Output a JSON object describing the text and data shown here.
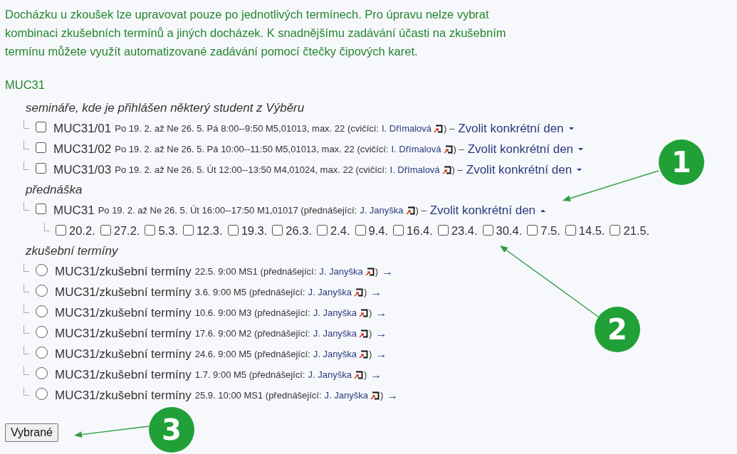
{
  "intro": "Docházku u zkoušek lze upravovat pouze po jednotlivých termínech. Pro úpravu nelze vybrat kombinaci zkušebních termínů a jiných docházek. K snadnějšímu zadávání účasti na zkušebním termínu můžete využít automatizované zadávání pomocí čtečky čipových karet.",
  "course": "MUC31",
  "groups": [
    {
      "heading": "semináře, kde je přihlášen některý student z Výběru",
      "items": [
        {
          "kind": "checkbox",
          "checked": false,
          "code": "MUC31/01",
          "details": "Po 19. 2. až Ne 26. 5. Pá 8:00--9:50 M5,01013, max. 22 (cvičící:",
          "person": "I. Dřímalová",
          "after": ") –",
          "link": "Zvolit konkrétní den",
          "expanded": false
        },
        {
          "kind": "checkbox",
          "checked": false,
          "code": "MUC31/02",
          "details": "Po 19. 2. až Ne 26. 5. Pá 10:00--11:50 M5,01013, max. 22 (cvičící:",
          "person": "I. Dřímalová",
          "after": ") –",
          "link": "Zvolit konkrétní den",
          "expanded": false
        },
        {
          "kind": "checkbox",
          "checked": false,
          "code": "MUC31/03",
          "details": "Po 19. 2. až Ne 26. 5. Út 12:00--13:50 M4,01024, max. 22 (cvičící:",
          "person": "I. Dřímalová",
          "after": ") –",
          "link": "Zvolit konkrétní den",
          "expanded": false
        }
      ]
    },
    {
      "heading": "přednáška",
      "items": [
        {
          "kind": "checkbox",
          "checked": false,
          "code": "MUC31",
          "details": "Po 19. 2. až Ne 26. 5. Út 16:00--17:50 M1,01017 (přednášející:",
          "person": "J. Janyška",
          "after": ") –",
          "link": "Zvolit konkrétní den",
          "expanded": true,
          "dates": [
            {
              "label": "20.2.",
              "checked": false
            },
            {
              "label": "27.2.",
              "checked": false
            },
            {
              "label": "5.3.",
              "checked": false
            },
            {
              "label": "12.3.",
              "checked": false
            },
            {
              "label": "19.3.",
              "checked": false
            },
            {
              "label": "26.3.",
              "checked": false
            },
            {
              "label": "2.4.",
              "checked": false
            },
            {
              "label": "9.4.",
              "checked": false
            },
            {
              "label": "16.4.",
              "checked": false
            },
            {
              "label": "23.4.",
              "checked": false
            },
            {
              "label": "30.4.",
              "checked": false
            },
            {
              "label": "7.5.",
              "checked": false
            },
            {
              "label": "14.5.",
              "checked": false
            },
            {
              "label": "21.5.",
              "checked": false
            }
          ]
        }
      ]
    },
    {
      "heading": "zkušební termíny",
      "items": [
        {
          "kind": "radio",
          "selected": false,
          "code": "MUC31/zkušební termíny",
          "details": "22.5. 9:00 MS1 (přednášející:",
          "person": "J. Janyška",
          "after": ")",
          "arrow": "→"
        },
        {
          "kind": "radio",
          "selected": false,
          "code": "MUC31/zkušební termíny",
          "details": "3.6. 9:00 M5 (přednášející:",
          "person": "J. Janyška",
          "after": ")",
          "arrow": "→"
        },
        {
          "kind": "radio",
          "selected": false,
          "code": "MUC31/zkušební termíny",
          "details": "10.6. 9:00 M3 (přednášející:",
          "person": "J. Janyška",
          "after": ")",
          "arrow": "→"
        },
        {
          "kind": "radio",
          "selected": false,
          "code": "MUC31/zkušební termíny",
          "details": "17.6. 9:00 M2 (přednášející:",
          "person": "J. Janyška",
          "after": ")",
          "arrow": "→"
        },
        {
          "kind": "radio",
          "selected": false,
          "code": "MUC31/zkušební termíny",
          "details": "24.6. 9:00 M5 (přednášející:",
          "person": "J. Janyška",
          "after": ")",
          "arrow": "→"
        },
        {
          "kind": "radio",
          "selected": false,
          "code": "MUC31/zkušební termíny",
          "details": "1.7. 9:00 M5 (přednášející:",
          "person": "J. Janyška",
          "after": ")",
          "arrow": "→"
        },
        {
          "kind": "radio",
          "selected": false,
          "code": "MUC31/zkušební termíny",
          "details": "25.9. 10:00 MS1 (přednášející:",
          "person": "J. Janyška",
          "after": ")",
          "arrow": "→"
        }
      ]
    }
  ],
  "button": "Vybrané",
  "annotations": [
    {
      "label": "1"
    },
    {
      "label": "2"
    },
    {
      "label": "3"
    }
  ]
}
